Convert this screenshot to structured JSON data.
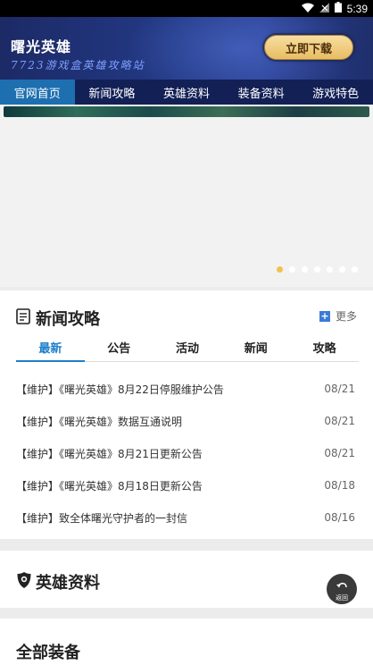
{
  "status_bar": {
    "time": "5:39"
  },
  "header": {
    "title": "曙光英雄",
    "subtitle": "7723游戏盒英雄攻略站",
    "download_label": "立即下载"
  },
  "nav": {
    "tabs": [
      {
        "label": "官网首页",
        "active": true
      },
      {
        "label": "新闻攻略"
      },
      {
        "label": "英雄资料"
      },
      {
        "label": "装备资料"
      },
      {
        "label": "游戏特色"
      }
    ]
  },
  "banner": {
    "slide_count": 7,
    "active_slide": 1
  },
  "news": {
    "title": "新闻攻略",
    "more_label": "更多",
    "tabs": [
      "最新",
      "公告",
      "活动",
      "新闻",
      "攻略"
    ],
    "items": [
      {
        "title": "【维护】《曙光英雄》8月22日停服维护公告",
        "date": "08/21"
      },
      {
        "title": "【维护】《曙光英雄》数据互通说明",
        "date": "08/21"
      },
      {
        "title": "【维护】《曙光英雄》8月21日更新公告",
        "date": "08/21"
      },
      {
        "title": "【维护】《曙光英雄》8月18日更新公告",
        "date": "08/18"
      },
      {
        "title": "【维护】致全体曙光守护者的一封信",
        "date": "08/16"
      }
    ]
  },
  "hero_section": {
    "title": "英雄资料"
  },
  "back_button": {
    "label": "返回"
  },
  "equipment_section": {
    "title": "全部装备"
  },
  "colors": {
    "header_bg": "#233985",
    "nav_bg": "#132056",
    "nav_active": "#1d6fb0",
    "tab_active": "#1d7fc9",
    "button_gold": "#e8bd63"
  }
}
